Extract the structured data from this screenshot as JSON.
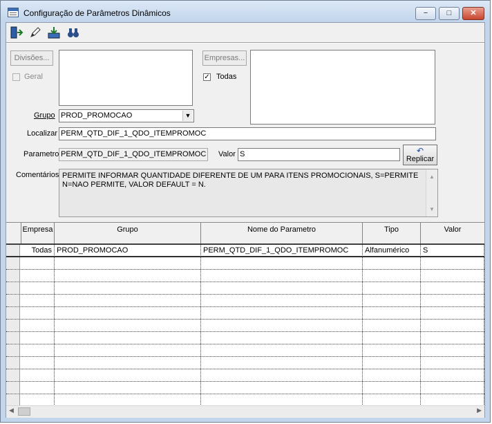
{
  "window": {
    "title": "Configuração de Parâmetros Dinâmicos",
    "min": "−",
    "max": "□",
    "close": "✕"
  },
  "toolbar": {
    "exit_icon": "exit-icon",
    "edit_icon": "pencil-icon",
    "save_icon": "save-icon",
    "find_icon": "binoculars-icon"
  },
  "form": {
    "divisoes_button": "Divisões...",
    "geral_label": "Geral",
    "empresas_button": "Empresas...",
    "todas_label": "Todas",
    "todas_checked": "✓",
    "grupo_label": "Grupo",
    "grupo_value": "PROD_PROMOCAO",
    "localizar_label": "Localizar",
    "localizar_value": "PERM_QTD_DIF_1_QDO_ITEMPROMOC",
    "parametro_label": "Parametro",
    "parametro_value": "PERM_QTD_DIF_1_QDO_ITEMPROMOC",
    "valor_label": "Valor",
    "valor_value": "S",
    "replicar_button": "Replicar",
    "comentarios_label": "Comentários",
    "comentarios_text": "PERMITE INFORMAR QUANTIDADE DIFERENTE DE UM PARA ITENS PROMOCIONAIS, S=PERMITE N=NAO PERMITE,  VALOR DEFAULT = N."
  },
  "grid": {
    "columns": [
      "Empresa",
      "Grupo",
      "Nome do Parametro",
      "Tipo",
      "Valor"
    ],
    "rows": [
      [
        "Todas",
        "PROD_PROMOCAO",
        "PERM_QTD_DIF_1_QDO_ITEMPROMOC",
        "Alfanumérico",
        "S"
      ]
    ]
  }
}
